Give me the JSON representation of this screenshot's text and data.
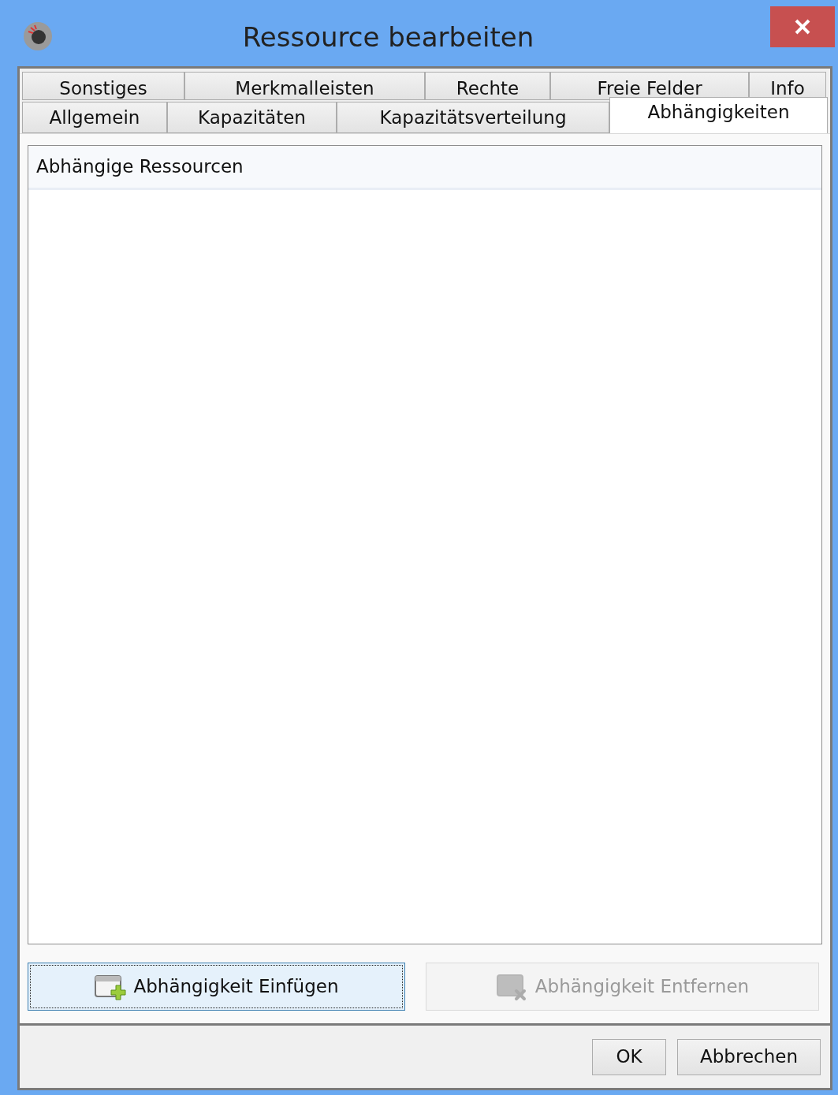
{
  "window": {
    "title": "Ressource bearbeiten"
  },
  "tab_rows": [
    [
      {
        "label": "Sonstiges",
        "selected": false
      },
      {
        "label": "Merkmalleisten",
        "selected": false
      },
      {
        "label": "Rechte",
        "selected": false
      },
      {
        "label": "Freie Felder",
        "selected": false
      },
      {
        "label": "Info",
        "selected": false
      }
    ],
    [
      {
        "label": "Allgemein",
        "selected": false
      },
      {
        "label": "Kapazitäten",
        "selected": false
      },
      {
        "label": "Kapazitätsverteilung",
        "selected": false
      },
      {
        "label": "Abhängigkeiten",
        "selected": true
      }
    ]
  ],
  "list": {
    "header": "Abhängige Ressourcen"
  },
  "actions": [
    {
      "label": "Abhängigkeit Einfügen",
      "kind": "add",
      "disabled": false,
      "focused": true
    },
    {
      "label": "Abhängigkeit Entfernen",
      "kind": "remove",
      "disabled": true,
      "focused": false
    }
  ],
  "dialog_buttons": [
    "OK",
    "Abbrechen"
  ]
}
